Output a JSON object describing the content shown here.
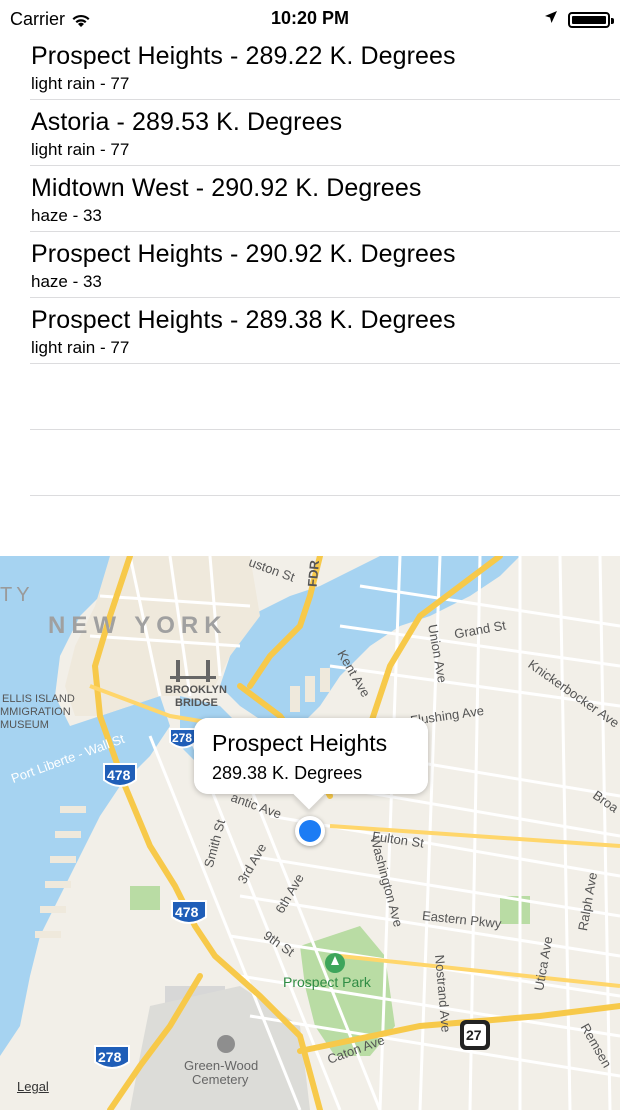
{
  "status_bar": {
    "carrier": "Carrier",
    "time": "10:20 PM",
    "battery_level_percent": 100
  },
  "list": {
    "rows": [
      {
        "title": "Prospect Heights - 289.22 K. Degrees",
        "subtitle": "light rain - 77"
      },
      {
        "title": "Astoria - 289.53 K. Degrees",
        "subtitle": "light rain - 77"
      },
      {
        "title": "Midtown West - 290.92 K. Degrees",
        "subtitle": "haze - 33"
      },
      {
        "title": "Prospect Heights - 290.92 K. Degrees",
        "subtitle": "haze - 33"
      },
      {
        "title": "Prospect Heights - 289.38 K. Degrees",
        "subtitle": "light rain - 77"
      },
      {
        "title": "",
        "subtitle": ""
      },
      {
        "title": "",
        "subtitle": ""
      }
    ]
  },
  "map": {
    "callout": {
      "title": "Prospect Heights",
      "subtitle": "289.38 K. Degrees"
    },
    "labels": {
      "new_york": "NEW YORK",
      "city_fragment": "TY",
      "brooklyn_bridge_1": "BROOKLYN",
      "brooklyn_bridge_2": "BRIDGE",
      "ellis_1": "ELLIS ISLAND",
      "ellis_2": "MMIGRATION",
      "ellis_3": "MUSEUM",
      "port_liberte": "Port Liberte - Wall St",
      "houston_st": "uston St",
      "fdr": "FDR",
      "grand_st": "Grand St",
      "kent_ave": "Kent Ave",
      "union_ave": "Union Ave",
      "knickerbocker_ave": "Knickerbocker Ave",
      "flushing_ave": "Flushing Ave",
      "broa": "Broa",
      "atlantic_ave": "antic Ave",
      "fulton_st": "Fulton St",
      "smith_st": "Smith St",
      "third_ave": "3rd Ave",
      "sixth_ave": "6th Ave",
      "ninth_st": "9th St",
      "washington_ave": "Washington Ave",
      "eastern_pkwy": "Eastern Pkwy",
      "ralph_ave": "Ralph Ave",
      "utica_ave": "Utica Ave",
      "nostrand_ave": "Nostrand Ave",
      "remsen": "Remsen",
      "prospect_park": "Prospect Park",
      "green_wood_1": "Green-Wood",
      "green_wood_2": "Cemetery",
      "caton_ave": "Caton Ave",
      "legal": "Legal"
    },
    "shields": {
      "i278_top": "278",
      "i478_a": "478",
      "i478_b": "478",
      "i278_bottom": "278",
      "route27": "27"
    },
    "colors": {
      "water": "#a6d3f1",
      "land": "#f2efe8",
      "park": "#b9dca4",
      "highway": "#f7c94a",
      "user_location": "#1c7cf4"
    }
  }
}
